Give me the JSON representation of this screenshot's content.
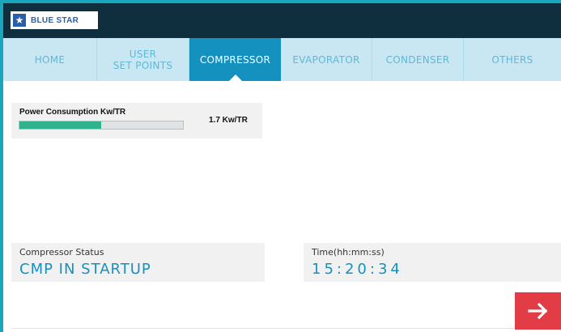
{
  "brand": {
    "name": "BLUE STAR",
    "logo_icon": "star-icon",
    "color": "#2a5ea8"
  },
  "nav": {
    "tabs": [
      {
        "label": "HOME",
        "active": false
      },
      {
        "label": "USER\nSET POINTS",
        "active": false
      },
      {
        "label": "COMPRESSOR",
        "active": true
      },
      {
        "label": "EVAPORATOR",
        "active": false
      },
      {
        "label": "CONDENSER",
        "active": false
      },
      {
        "label": "OTHERS",
        "active": false
      }
    ]
  },
  "power": {
    "label": "Power Consumption Kw/TR",
    "value": "1.7 Kw/TR",
    "bar_fraction": 0.5,
    "bar_color": "#2fb38f"
  },
  "status": {
    "label": "Compressor Status",
    "value": "CMP IN STARTUP"
  },
  "time": {
    "label": "Time(hh:mm:ss)",
    "value": "15:20:34"
  },
  "next_button": {
    "icon": "arrow-right-icon",
    "color": "#e23c47"
  },
  "colors": {
    "frame": "#1aa6bd",
    "topbar": "#0f2e3e",
    "nav_bg": "#c9e7f3",
    "nav_active": "#1591bf",
    "value_text": "#1591bf"
  }
}
